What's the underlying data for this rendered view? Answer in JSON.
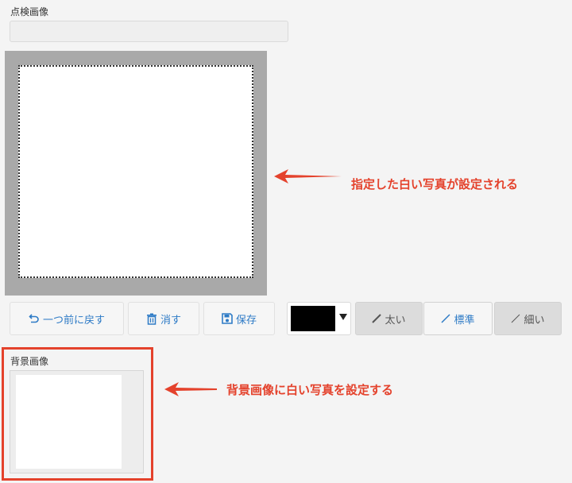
{
  "inspection": {
    "label": "点検画像"
  },
  "toolbar": {
    "undo_label": "一つ前に戻す",
    "clear_label": "消す",
    "save_label": "保存",
    "pen_color": "#000000",
    "pen_thick_label": "太い",
    "pen_standard_label": "標準",
    "pen_thin_label": "細い"
  },
  "background": {
    "label": "背景画像"
  },
  "annotations": {
    "canvas_note": "指定した白い写真が設定される",
    "background_note": "背景画像に白い写真を設定する",
    "accent_color": "#e4422c"
  },
  "icons": {
    "undo": "undo-icon",
    "trash": "trash-icon",
    "save": "floppy-disk-icon",
    "pen": "pen-line-icon",
    "dropdown": "caret-down-icon",
    "arrow": "arrow-left-icon"
  }
}
